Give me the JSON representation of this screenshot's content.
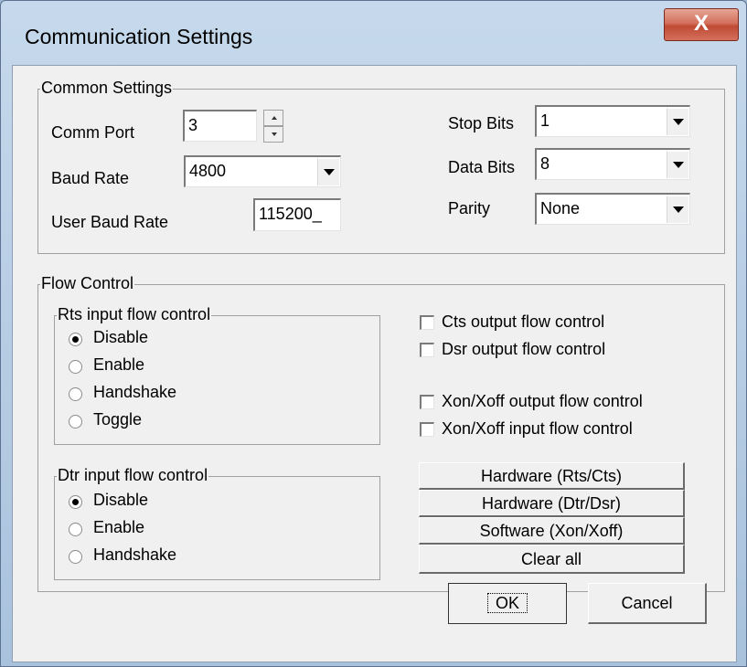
{
  "window": {
    "title": "Communication Settings",
    "close_glyph": "X"
  },
  "common": {
    "label": "Common Settings",
    "comm_port": {
      "label": "Comm Port",
      "value": "3"
    },
    "baud_rate": {
      "label": "Baud Rate",
      "value": "4800"
    },
    "user_baud_rate": {
      "label": "User Baud Rate",
      "value": "115200_"
    },
    "stop_bits": {
      "label": "Stop Bits",
      "value": "1"
    },
    "data_bits": {
      "label": "Data Bits",
      "value": "8"
    },
    "parity": {
      "label": "Parity",
      "value": "None"
    }
  },
  "flow": {
    "label": "Flow Control",
    "rts": {
      "label": "Rts input flow control",
      "options": [
        "Disable",
        "Enable",
        "Handshake",
        "Toggle"
      ],
      "selected": "Disable"
    },
    "dtr": {
      "label": "Dtr input flow control",
      "options": [
        "Disable",
        "Enable",
        "Handshake"
      ],
      "selected": "Disable"
    },
    "checks": [
      {
        "label": "Cts output flow control",
        "checked": false
      },
      {
        "label": "Dsr output flow control",
        "checked": false
      },
      {
        "label": "Xon/Xoff output flow control",
        "checked": false
      },
      {
        "label": "Xon/Xoff input flow control",
        "checked": false
      }
    ],
    "presets": [
      "Hardware (Rts/Cts)",
      "Hardware (Dtr/Dsr)",
      "Software (Xon/Xoff)",
      "Clear all"
    ]
  },
  "buttons": {
    "ok": "OK",
    "cancel": "Cancel"
  }
}
